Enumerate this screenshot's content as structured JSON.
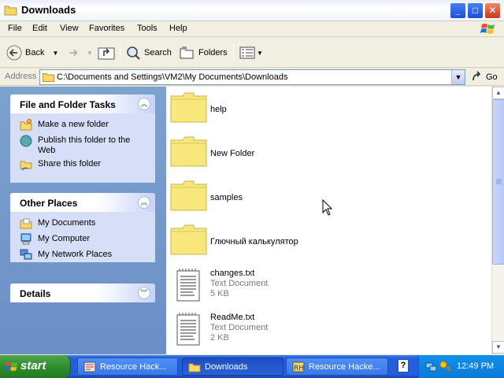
{
  "window": {
    "title": "Downloads"
  },
  "menu": [
    "File",
    "Edit",
    "View",
    "Favorites",
    "Tools",
    "Help"
  ],
  "toolbar": {
    "back": "Back",
    "search": "Search",
    "folders": "Folders"
  },
  "address": {
    "label": "Address",
    "path": "C:\\Documents and Settings\\VM2\\My Documents\\Downloads",
    "go": "Go"
  },
  "panels": {
    "file_tasks": {
      "title": "File and Folder Tasks",
      "items": [
        "Make a new folder",
        "Publish this folder to the Web",
        "Share this folder"
      ]
    },
    "other_places": {
      "title": "Other Places",
      "items": [
        "My Documents",
        "My Computer",
        "My Network Places"
      ]
    },
    "details": {
      "title": "Details"
    }
  },
  "files": [
    {
      "name": "help",
      "type": "folder"
    },
    {
      "name": "New Folder",
      "type": "folder"
    },
    {
      "name": "samples",
      "type": "folder"
    },
    {
      "name": "Глючный калькулятор",
      "type": "folder"
    },
    {
      "name": "changes.txt",
      "kind": "Text Document",
      "size": "5 KB",
      "type": "file"
    },
    {
      "name": "ReadMe.txt",
      "kind": "Text Document",
      "size": "2 KB",
      "type": "file"
    }
  ],
  "taskbar": {
    "start": "start",
    "buttons": [
      "Resource Hack...",
      "Downloads",
      "Resource Hacke..."
    ],
    "help": "?",
    "clock": "12:49 PM"
  },
  "colors": {
    "folder": "#f7e77c",
    "xp_blue": "#245edb",
    "start_green": "#2b8a2a"
  }
}
